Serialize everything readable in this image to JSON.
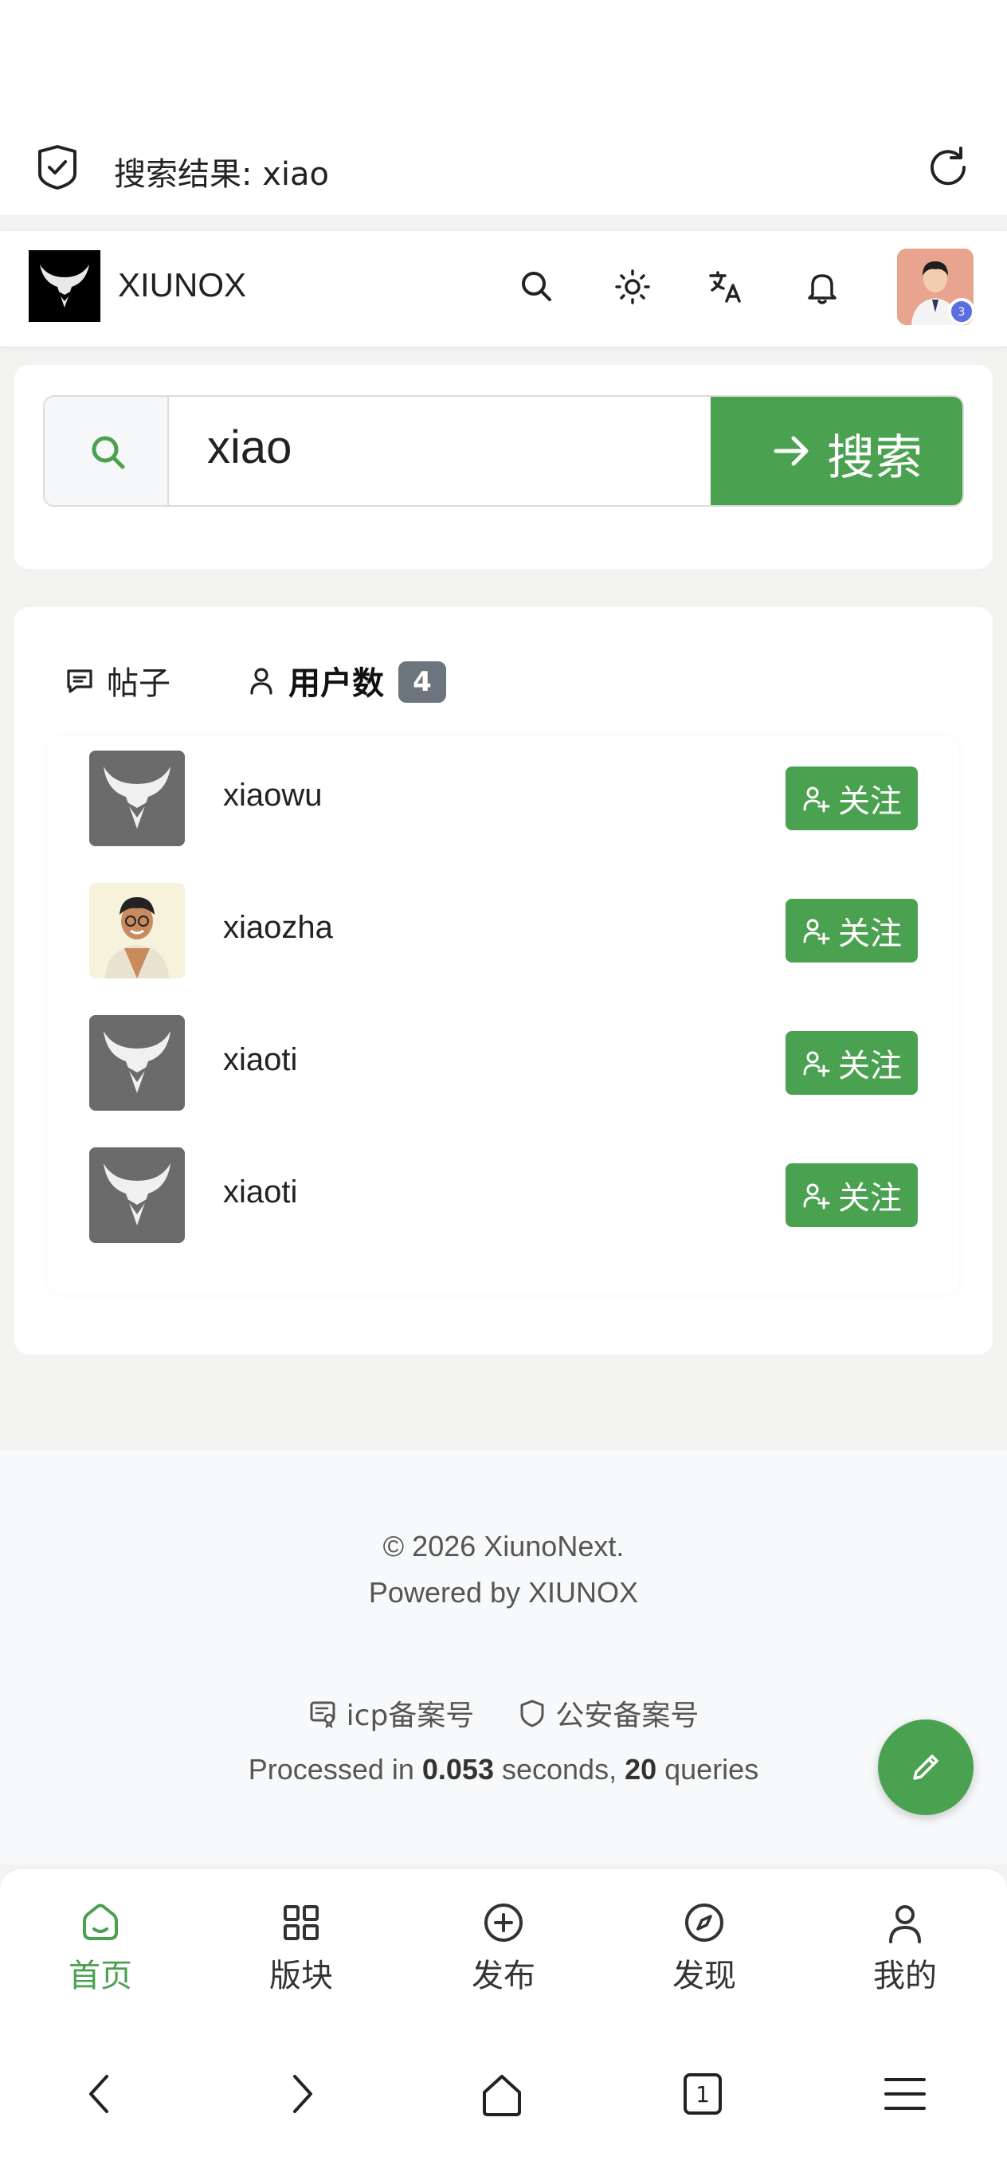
{
  "browser": {
    "page_title": "搜索结果: xiao"
  },
  "header": {
    "brand": "XIUNOX",
    "notification_count": "3"
  },
  "search": {
    "value": "xiao",
    "button_label": "搜索"
  },
  "tabs": [
    {
      "label": "帖子"
    },
    {
      "label": "用户数",
      "count": "4"
    }
  ],
  "users": [
    {
      "name": "xiaowu",
      "avatar": "default-logo"
    },
    {
      "name": "xiaozha",
      "avatar": "cartoon-man"
    },
    {
      "name": "xiaoti",
      "avatar": "default-logo"
    },
    {
      "name": "xiaoti",
      "avatar": "default-logo"
    }
  ],
  "follow_label": "关注",
  "footer": {
    "copyright": "© 2026 XiunoNext.",
    "powered": "Powered by XIUNOX",
    "icp": "icp备案号",
    "police": "公安备案号",
    "processed_prefix": "Processed in ",
    "seconds": "0.053",
    "seconds_suffix": " seconds, ",
    "queries": "20",
    "queries_suffix": " queries"
  },
  "bottom_nav": [
    {
      "label": "首页",
      "icon": "home-icon",
      "active": true
    },
    {
      "label": "版块",
      "icon": "grid-icon"
    },
    {
      "label": "发布",
      "icon": "plus-circle-icon"
    },
    {
      "label": "发现",
      "icon": "compass-icon"
    },
    {
      "label": "我的",
      "icon": "user-icon"
    }
  ],
  "system_nav": {
    "tab_count": "1"
  },
  "colors": {
    "primary": "#4aa150",
    "badge": "#6c757d"
  }
}
